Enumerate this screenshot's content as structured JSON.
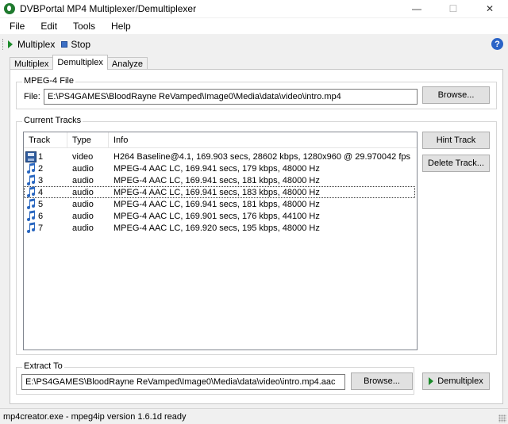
{
  "window": {
    "title": "DVBPortal MP4 Multiplexer/Demultiplexer",
    "minimize": "—",
    "maximize": "☐",
    "close": "✕"
  },
  "menu": [
    "File",
    "Edit",
    "Tools",
    "Help"
  ],
  "toolbar": {
    "multiplex_label": "Multiplex",
    "stop_label": "Stop",
    "help_glyph": "?"
  },
  "tabs": [
    {
      "label": "Multiplex",
      "active": false
    },
    {
      "label": "Demultiplex",
      "active": true
    },
    {
      "label": "Analyze",
      "active": false
    }
  ],
  "mpeg4_file": {
    "group_label": "MPEG-4 File",
    "file_label": "File:",
    "file_value": "E:\\PS4GAMES\\BloodRayne ReVamped\\Image0\\Media\\data\\video\\intro.mp4",
    "browse_label": "Browse..."
  },
  "current_tracks": {
    "group_label": "Current Tracks",
    "columns": [
      "Track",
      "Type",
      "Info"
    ],
    "rows": [
      {
        "track": "1",
        "type": "video",
        "info": "H264 Baseline@4.1, 169.903 secs, 28602 kbps, 1280x960 @ 29.970042 fps",
        "icon": "video-track-icon"
      },
      {
        "track": "2",
        "type": "audio",
        "info": "MPEG-4 AAC LC, 169.941 secs, 179 kbps, 48000 Hz",
        "icon": "audio-track-icon"
      },
      {
        "track": "3",
        "type": "audio",
        "info": "MPEG-4 AAC LC, 169.941 secs, 181 kbps, 48000 Hz",
        "icon": "audio-track-icon"
      },
      {
        "track": "4",
        "type": "audio",
        "info": "MPEG-4 AAC LC, 169.941 secs, 183 kbps, 48000 Hz",
        "icon": "audio-track-icon"
      },
      {
        "track": "5",
        "type": "audio",
        "info": "MPEG-4 AAC LC, 169.941 secs, 181 kbps, 48000 Hz",
        "icon": "audio-track-icon"
      },
      {
        "track": "6",
        "type": "audio",
        "info": "MPEG-4 AAC LC, 169.901 secs, 176 kbps, 44100 Hz",
        "icon": "audio-track-icon"
      },
      {
        "track": "7",
        "type": "audio",
        "info": "MPEG-4 AAC LC, 169.920 secs, 195 kbps, 48000 Hz",
        "icon": "audio-track-icon"
      }
    ],
    "focused_row": "4",
    "hint_track_label": "Hint Track",
    "delete_track_label": "Delete Track..."
  },
  "extract_to": {
    "group_label": "Extract To",
    "path_value": "E:\\PS4GAMES\\BloodRayne ReVamped\\Image0\\Media\\data\\video\\intro.mp4.aac",
    "browse_label": "Browse...",
    "demultiplex_label": "Demultiplex"
  },
  "status": {
    "text": "mp4creator.exe - mpeg4ip version 1.6.1d ready"
  },
  "colors": {
    "accent_green": "#1b8a2a",
    "stop_blue": "#3c6fc4",
    "help_blue": "#2b63c6"
  }
}
